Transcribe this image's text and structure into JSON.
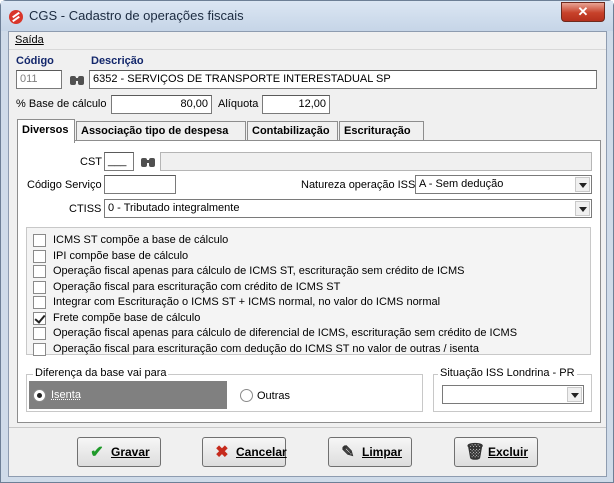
{
  "window": {
    "title": "CGS - Cadastro de operações fiscais",
    "close_glyph": "✕"
  },
  "menu": {
    "items": [
      {
        "label": "Saída"
      }
    ]
  },
  "header": {
    "codigo_label": "Código",
    "codigo_value": "011",
    "descricao_label": "Descrição",
    "descricao_value": "6352 - SERVIÇOS DE TRANSPORTE INTERESTADUAL  SP",
    "base_calculo_label": "% Base de cálculo",
    "base_calculo_value": "80,00",
    "aliquota_label": "Alíquota",
    "aliquota_value": "12,00"
  },
  "tabs": [
    {
      "label": "Diversos",
      "active": true
    },
    {
      "label": "Associação tipo de despesa",
      "active": false
    },
    {
      "label": "Contabilização",
      "active": false
    },
    {
      "label": "Escrituração",
      "active": false
    }
  ],
  "diversos": {
    "cst_label": "CST",
    "cst_value": "___",
    "cst_desc_value": "",
    "codigo_servico_label": "Código Serviço",
    "codigo_servico_value": "",
    "natureza_iss_label": "Natureza operação ISS",
    "natureza_iss_value": "A - Sem dedução",
    "ctiss_label": "CTISS",
    "ctiss_value": "0 - Tributado integralmente",
    "checkboxes": [
      {
        "label": "ICMS ST compõe a base de cálculo",
        "checked": false
      },
      {
        "label": "IPI compõe base de cálculo",
        "checked": false
      },
      {
        "label": "Operação fiscal apenas para cálculo de ICMS ST, escrituração sem crédito de ICMS",
        "checked": false
      },
      {
        "label": "Operação fiscal para escrituração com crédito de ICMS ST",
        "checked": false
      },
      {
        "label": "Integrar com Escrituração o ICMS ST + ICMS normal,  no valor do ICMS normal",
        "checked": false
      },
      {
        "label": "Frete compõe base de cálculo",
        "checked": true
      },
      {
        "label": "Operação fiscal apenas para cálculo de diferencial de ICMS, escrituração sem crédito de ICMS",
        "checked": false
      },
      {
        "label": "Operação fiscal para escrituração com dedução do ICMS ST no valor de outras / isenta",
        "checked": false
      }
    ],
    "diferenca_label": "Diferença da base vai para",
    "radio_isenta": "Isenta",
    "radio_outras": "Outras",
    "radio_selected": "Isenta",
    "situacao_iss_label": "Situação ISS Londrina - PR",
    "situacao_iss_value": ""
  },
  "buttons": {
    "gravar": {
      "label": "Gravar",
      "icon": "check-icon",
      "color": "#1f9a2a"
    },
    "cancelar": {
      "label": "Cancelar",
      "icon": "x-icon",
      "color": "#c62a1c"
    },
    "limpar": {
      "label": "Limpar",
      "icon": "broom-icon"
    },
    "excluir": {
      "label": "Excluir",
      "icon": "trash-icon"
    }
  },
  "colors": {
    "selected_group": "#808080",
    "label_blue": "#13276b"
  }
}
